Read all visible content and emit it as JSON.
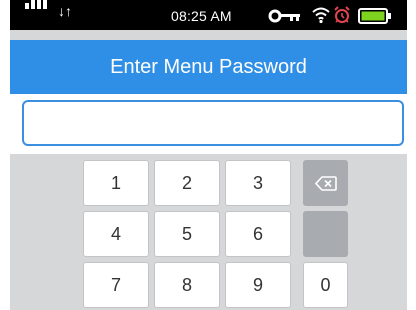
{
  "status_bar": {
    "time": "08:25 AM",
    "signal_icon": "cell-signal-icon",
    "sync_icon": "data-sync-icon",
    "key_icon": "key-icon",
    "wifi_icon": "wifi-icon",
    "alarm_icon": "alarm-clock-icon",
    "battery_icon": "battery-icon",
    "battery_color": "#7ed321"
  },
  "header": {
    "title": "Enter Menu Password",
    "background_color": "#2f8ee6"
  },
  "password_field": {
    "value": "",
    "placeholder": "",
    "border_color": "#3b8fe0"
  },
  "keypad": {
    "keys": [
      "1",
      "2",
      "3",
      "4",
      "5",
      "6",
      "7",
      "8",
      "9",
      "0"
    ],
    "backspace_icon": "backspace-icon"
  }
}
